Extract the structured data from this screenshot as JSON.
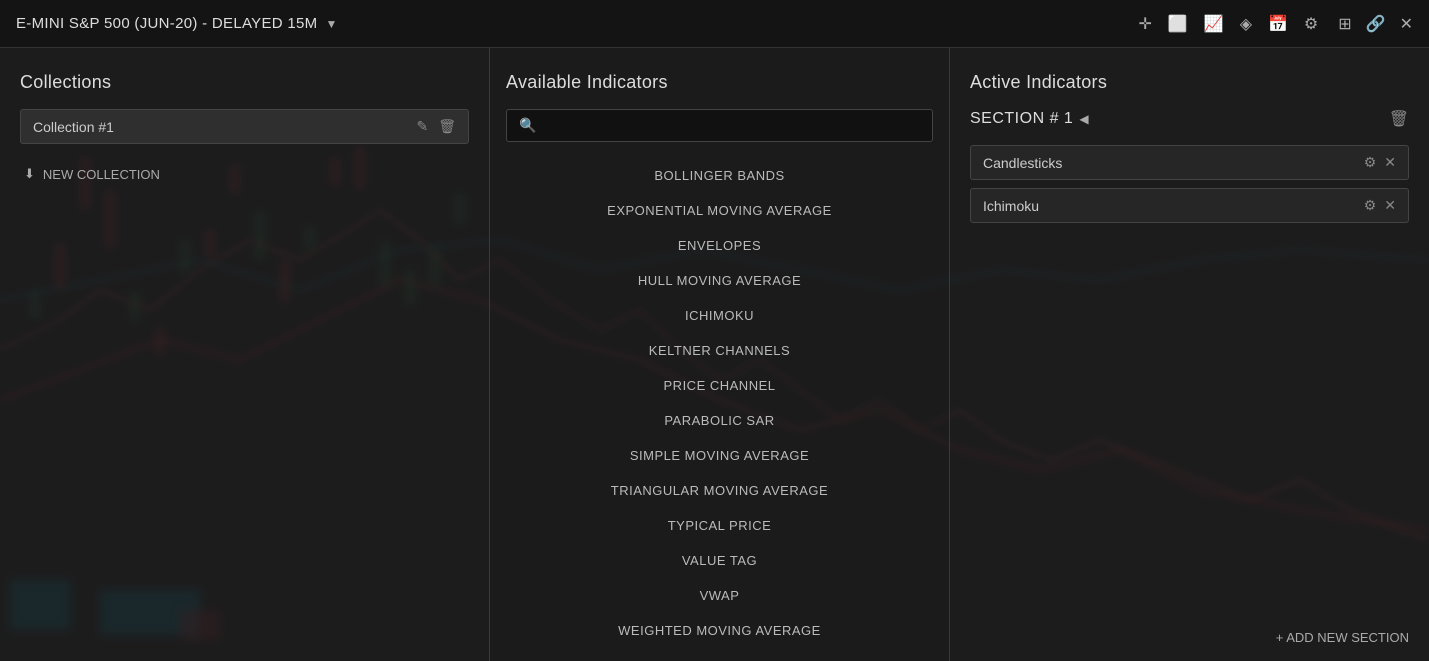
{
  "title_bar": {
    "symbol": "E-MINI S&P 500 (JUN-20) - DELAYED 15M",
    "dropdown_icon": "▼",
    "toolbar_icons": [
      "crosshair-icon",
      "price-icon",
      "chart-icon",
      "layers-icon",
      "calendar-icon",
      "settings-icon"
    ],
    "window_icons": [
      "grid-icon",
      "link-icon",
      "close-icon"
    ]
  },
  "collections_panel": {
    "title": "Collections",
    "collection_name": "Collection #1",
    "edit_icon": "✎",
    "delete_icon": "🗑",
    "new_collection_label": "NEW COLLECTION",
    "new_collection_icon": "⬇"
  },
  "available_indicators_panel": {
    "title": "Available Indicators",
    "search_placeholder": "",
    "indicators": [
      "BOLLINGER BANDS",
      "EXPONENTIAL MOVING AVERAGE",
      "ENVELOPES",
      "HULL MOVING AVERAGE",
      "ICHIMOKU",
      "KELTNER CHANNELS",
      "PRICE CHANNEL",
      "PARABOLIC SAR",
      "SIMPLE MOVING AVERAGE",
      "TRIANGULAR MOVING AVERAGE",
      "TYPICAL PRICE",
      "VALUE TAG",
      "VWAP",
      "WEIGHTED MOVING AVERAGE"
    ]
  },
  "active_indicators_panel": {
    "title": "Active Indicators",
    "section_title": "SECTION # 1",
    "section_arrow": "◀",
    "delete_section_icon": "🗑",
    "active_items": [
      {
        "name": "Candlesticks"
      },
      {
        "name": "Ichimoku"
      }
    ],
    "gear_icon": "⚙",
    "close_icon": "✕",
    "add_section_label": "+ ADD NEW SECTION"
  }
}
